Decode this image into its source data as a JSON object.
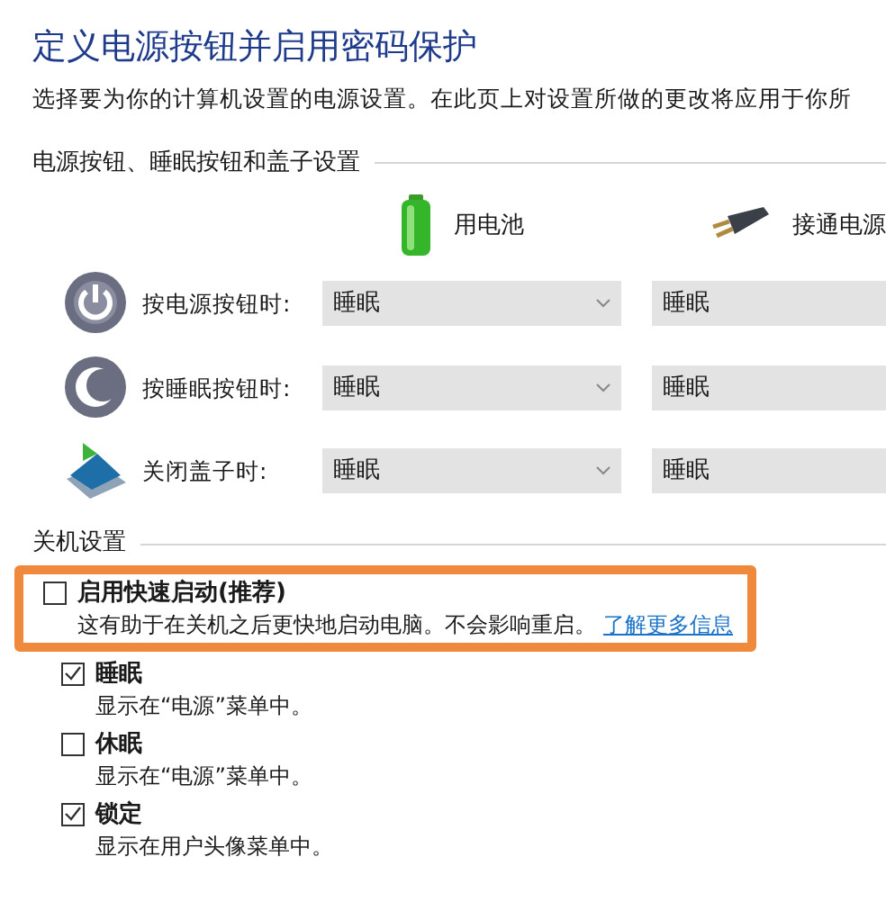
{
  "title": "定义电源按钮并启用密码保护",
  "subtitle": "选择要为你的计算机设置的电源设置。在此页上对设置所做的更改将应用于你所",
  "buttons_section": {
    "heading": "电源按钮、睡眠按钮和盖子设置",
    "columns": [
      {
        "kind": "battery",
        "label": "用电池"
      },
      {
        "kind": "plug",
        "label": "接通电源"
      }
    ],
    "rows": [
      {
        "kind": "power",
        "label": "按电源按钮时:",
        "values": [
          "睡眠",
          "睡眠"
        ]
      },
      {
        "kind": "sleep",
        "label": "按睡眠按钮时:",
        "values": [
          "睡眠",
          "睡眠"
        ]
      },
      {
        "kind": "lid",
        "label": "关闭盖子时:",
        "values": [
          "睡眠",
          "睡眠"
        ]
      }
    ]
  },
  "shutdown_section": {
    "heading": "关机设置",
    "options": [
      {
        "label": "启用快速启动(推荐)",
        "checked": false,
        "highlighted": true,
        "description": "这有助于在关机之后更快地启动电脑。不会影响重启。",
        "link": "了解更多信息"
      },
      {
        "label": "睡眠",
        "checked": true,
        "highlighted": false,
        "description": "显示在“电源”菜单中。"
      },
      {
        "label": "休眠",
        "checked": false,
        "highlighted": false,
        "description": "显示在“电源”菜单中。"
      },
      {
        "label": "锁定",
        "checked": true,
        "highlighted": false,
        "description": "显示在用户头像菜单中。"
      }
    ]
  }
}
